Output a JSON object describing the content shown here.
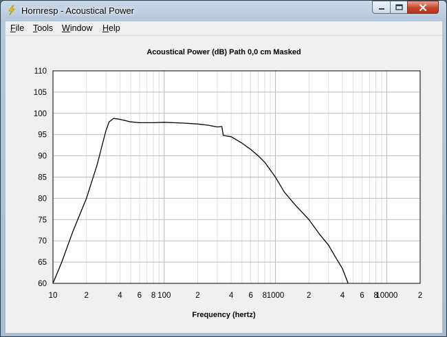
{
  "window": {
    "title": "Hornresp - Acoustical Power",
    "icon": "lightning-bolt-icon",
    "controls": [
      "minimize-icon",
      "maximize-icon",
      "close-icon"
    ]
  },
  "menu": [
    {
      "label": "File",
      "underline": "F"
    },
    {
      "label": "Tools",
      "underline": "T"
    },
    {
      "label": "Window",
      "underline": "W"
    },
    {
      "label": "Help",
      "underline": "H"
    }
  ],
  "chart_data": {
    "type": "line",
    "title": "Acoustical Power (dB)   Path 0,0 cm   Masked",
    "xlabel": "Frequency (hertz)",
    "ylabel": "",
    "xscale": "log",
    "xlim": [
      10,
      20000
    ],
    "ylim": [
      60,
      110
    ],
    "grid": true,
    "y_ticks": [
      "110",
      "105",
      "100",
      "95",
      "90",
      "85",
      "80",
      "75",
      "70",
      "65",
      "60"
    ],
    "x_ticks": [
      {
        "v": 10,
        "l": "10"
      },
      {
        "v": 20,
        "l": "2"
      },
      {
        "v": 40,
        "l": "4"
      },
      {
        "v": 60,
        "l": "6"
      },
      {
        "v": 80,
        "l": "8"
      },
      {
        "v": 100,
        "l": "100"
      },
      {
        "v": 200,
        "l": "2"
      },
      {
        "v": 400,
        "l": "4"
      },
      {
        "v": 600,
        "l": "6"
      },
      {
        "v": 800,
        "l": "8"
      },
      {
        "v": 1000,
        "l": "1000"
      },
      {
        "v": 2000,
        "l": "2"
      },
      {
        "v": 4000,
        "l": "4"
      },
      {
        "v": 6000,
        "l": "6"
      },
      {
        "v": 8000,
        "l": "8"
      },
      {
        "v": 10000,
        "l": "10000"
      },
      {
        "v": 20000,
        "l": "2"
      }
    ],
    "series": [
      {
        "color": "#000000",
        "x": [
          10,
          12,
          15,
          20,
          25,
          28,
          30,
          32,
          35,
          40,
          50,
          60,
          80,
          100,
          150,
          200,
          250,
          300,
          330,
          340,
          360,
          400,
          500,
          600,
          700,
          800,
          1000,
          1200,
          1500,
          2000,
          2500,
          3000,
          3500,
          4000,
          4500
        ],
        "y": [
          60,
          65,
          72,
          80,
          88,
          93,
          96,
          98,
          98.8,
          98.6,
          98,
          97.8,
          97.8,
          97.9,
          97.7,
          97.5,
          97.2,
          96.8,
          96.9,
          94.8,
          94.7,
          94.5,
          93,
          91.5,
          90,
          88.5,
          85,
          81.5,
          78.5,
          75,
          71.5,
          69,
          66,
          63.5,
          60
        ]
      }
    ]
  }
}
